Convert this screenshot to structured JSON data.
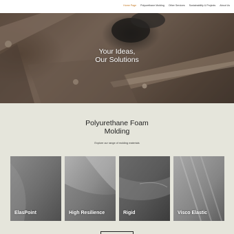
{
  "nav": {
    "links": [
      {
        "label": "Home Page",
        "active": true
      },
      {
        "label": "Polyurethane Molding",
        "active": false
      },
      {
        "label": "Other Services",
        "active": false
      },
      {
        "label": "Sustainability & Projects",
        "active": false
      },
      {
        "label": "About Us",
        "active": false
      }
    ],
    "active_color": "#c2761f"
  },
  "hero": {
    "title_line1": "Your Ideas,",
    "title_line2": "Our Solutions"
  },
  "section": {
    "title_line1": "Polyurethane Foam",
    "title_line2": "Molding",
    "subtitle": "Explore our range of molding materials",
    "background": "#e5e5db"
  },
  "cards": [
    {
      "label": "ElasPoint"
    },
    {
      "label": "High Resilience"
    },
    {
      "label": "Rigid"
    },
    {
      "label": "Visco Elastic"
    }
  ]
}
